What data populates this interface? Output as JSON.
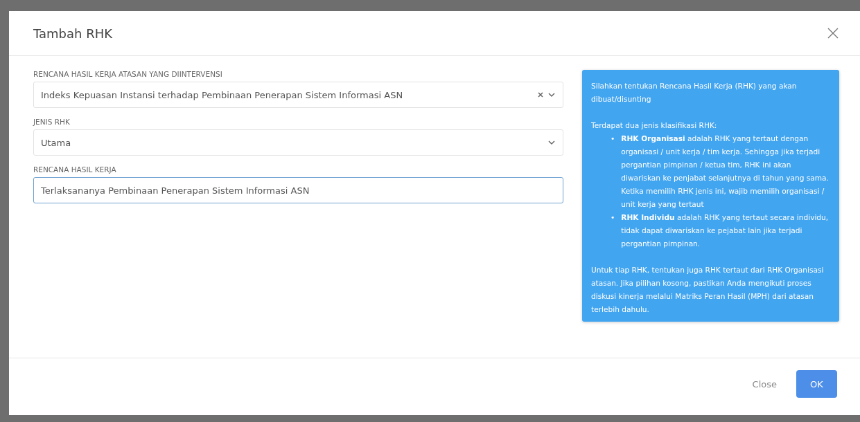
{
  "dialog": {
    "title": "Tambah RHK"
  },
  "fields": [
    {
      "kind": "select",
      "label": "RENCANA HASIL KERJA ATASAN YANG DIINTERVENSI",
      "value": "Indeks Kepuasan Instansi terhadap Pembinaan Penerapan Sistem Informasi ASN",
      "clearable": true,
      "focused": false
    },
    {
      "kind": "select",
      "label": "JENIS RHK",
      "value": "Utama",
      "clearable": false,
      "focused": false
    },
    {
      "kind": "input",
      "label": "RENCANA HASIL KERJA",
      "value": "Terlaksananya Pembinaan Penerapan Sistem Informasi ASN",
      "focused": true
    }
  ],
  "info": {
    "intro": "Silahkan tentukan Rencana Hasil Kerja (RHK) yang akan dibuat/disunting",
    "list_title": "Terdapat dua jenis klasifikasi RHK:",
    "items": [
      {
        "bullet": "•",
        "text": "**RHK Organisasi** adalah RHK yang tertaut dengan organisasi / unit kerja / tim kerja. Sehingga jika terjadi pergantian pimpinan / ketua tim, RHK ini akan diwariskan ke penjabat selanjutnya di tahun yang sama. Ketika memilih RHK jenis ini, wajib memilih organisasi / unit kerja yang tertaut"
      },
      {
        "bullet": "•",
        "text": "**RHK Individu** adalah RHK yang tertaut secara individu, tidak dapat diwariskan ke pejabat lain jika terjadi pergantian pimpinan."
      }
    ],
    "outro": "Untuk tiap RHK, tentukan juga RHK tertaut dari RHK Organisasi atasan. Jika pilihan kosong, pastikan Anda mengikuti proses diskusi kinerja melalui Matriks Peran Hasil (MPH) dari atasan terlebih dahulu."
  },
  "buttons": [
    {
      "kind": "link",
      "label": "Close"
    },
    {
      "kind": "primary",
      "label": "OK"
    }
  ]
}
